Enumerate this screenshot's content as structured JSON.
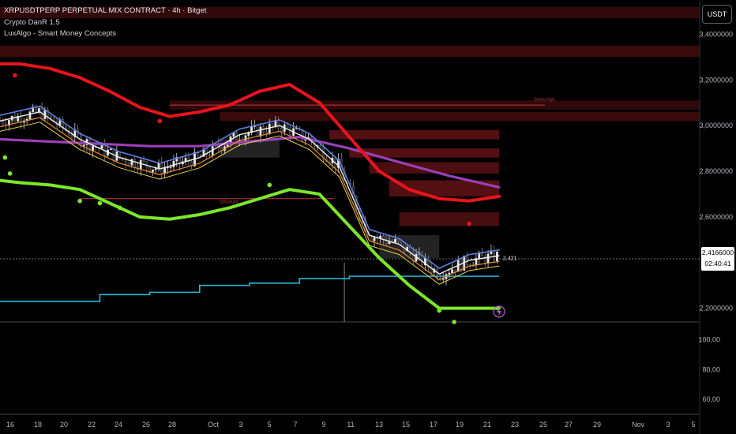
{
  "legend": {
    "symbol": "XRPUSDTPERP PERPETUAL MIX CONTRACT · 4h · Bitget",
    "indicator1": "Crypto DanR 1.5",
    "indicator2": "LuxAlgo - Smart Money Concepts"
  },
  "currency_button": "USDT",
  "price_tag": {
    "price": "2,4166000",
    "countdown": "02:40:41"
  },
  "last_label": "2.421",
  "colors": {
    "background": "#000000",
    "upper_band": "#e8141c",
    "lower_band": "#7ce72c",
    "vwap_line": "#25b8d8",
    "ma_purple": "#9b3fb5",
    "ma_blue": "#5b7fe0",
    "ma_white": "#f0f0f0",
    "ma_orange": "#ef8a2e",
    "ma_yellow": "#e8d24a",
    "supply_zone": "#8b1a1f",
    "demand_zone": "#3a3a3a"
  },
  "chart_data": {
    "type": "line",
    "title": "XRPUSDTPERP PERPETUAL MIX CONTRACT · 4h · Bitget",
    "x_labels": [
      "16",
      "18",
      "20",
      "22",
      "24",
      "26",
      "28",
      "Oct",
      "3",
      "5",
      "7",
      "9",
      "11",
      "13",
      "15",
      "17",
      "19",
      "21",
      "23",
      "25",
      "27",
      "29",
      "Nov",
      "3",
      "5"
    ],
    "y_ticks": [
      "3,4000000",
      "3,2000000",
      "3,0000000",
      "2,8000000",
      "2,6000000",
      "2,2000000"
    ],
    "y_range": [
      2.14,
      3.55
    ],
    "osc_ticks": [
      "100,00",
      "80,00",
      "60,00"
    ],
    "osc_range": [
      50,
      112
    ],
    "annotations": [
      "Strong High",
      "Discount"
    ],
    "series": [
      {
        "x": [
          0,
          2,
          5,
          8,
          11,
          14,
          17,
          20,
          23,
          26,
          29,
          32,
          35,
          38,
          41,
          44,
          47,
          50
        ],
        "values": [
          3.27,
          3.27,
          3.25,
          3.21,
          3.15,
          3.08,
          3.04,
          3.06,
          3.09,
          3.15,
          3.18,
          3.1,
          2.95,
          2.8,
          2.72,
          2.68,
          2.67,
          2.69
        ]
      },
      {
        "x": [
          0,
          2,
          5,
          8,
          11,
          14,
          17,
          20,
          23,
          26,
          29,
          32,
          35,
          38,
          41,
          44,
          47,
          50
        ],
        "values": [
          2.76,
          2.75,
          2.74,
          2.72,
          2.66,
          2.6,
          2.59,
          2.61,
          2.64,
          2.68,
          2.72,
          2.7,
          2.56,
          2.42,
          2.3,
          2.2,
          2.2,
          2.2
        ]
      },
      {
        "x": [
          0,
          5,
          10,
          15,
          20,
          25,
          30,
          35,
          40,
          45,
          50
        ],
        "values": [
          2.23,
          2.23,
          2.26,
          2.27,
          2.3,
          2.31,
          2.33,
          2.34,
          2.34,
          2.34,
          2.34
        ]
      },
      {
        "x": [
          0,
          5,
          10,
          15,
          20,
          25,
          30,
          35,
          40,
          45,
          50
        ],
        "values": [
          2.94,
          2.93,
          2.92,
          2.91,
          2.91,
          2.93,
          2.95,
          2.9,
          2.84,
          2.78,
          2.73
        ]
      },
      {
        "x": [
          0,
          4,
          8,
          12,
          16,
          20,
          24,
          28,
          31,
          34,
          37,
          40,
          44,
          47,
          50
        ],
        "values": [
          3.02,
          3.06,
          2.94,
          2.86,
          2.81,
          2.86,
          2.96,
          3.0,
          2.94,
          2.82,
          2.52,
          2.48,
          2.35,
          2.41,
          2.43
        ]
      }
    ]
  }
}
